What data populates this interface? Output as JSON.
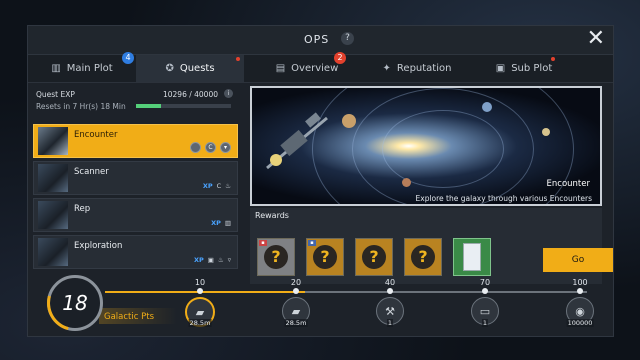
{
  "window": {
    "title": "OPS",
    "help_glyph": "?",
    "close_glyph": "✕"
  },
  "tabs": [
    {
      "label": "Main Plot",
      "icon": "book-icon",
      "badge": "4"
    },
    {
      "label": "Quests",
      "icon": "target-icon",
      "active": true
    },
    {
      "label": "Overview",
      "icon": "list-icon",
      "badge": "2"
    },
    {
      "label": "Reputation",
      "icon": "medal-icon"
    },
    {
      "label": "Sub Plot",
      "icon": "document-icon"
    }
  ],
  "quest_exp": {
    "label": "Quest EXP",
    "value": "10296 / 40000",
    "reset": "Resets in 7 Hr(s) 18 Min",
    "progress": 0.26
  },
  "quests": [
    {
      "name": "Encounter",
      "selected": true,
      "tags": [
        "C"
      ]
    },
    {
      "name": "Scanner",
      "tags": [
        "XP",
        "C"
      ]
    },
    {
      "name": "Rep",
      "tags": [
        "XP"
      ]
    },
    {
      "name": "Exploration",
      "tags": [
        "XP"
      ]
    }
  ],
  "hero": {
    "title": "Encounter",
    "description": "Explore the galaxy through various Encounters"
  },
  "rewards": {
    "label": "Rewards",
    "go_label": "Go"
  },
  "galactic": {
    "value": "18",
    "label": "Galactic Pts",
    "progress": 0.18,
    "milestones": [
      {
        "points": "10",
        "count": "28.5m",
        "reached": true
      },
      {
        "points": "20",
        "count": "28.5m"
      },
      {
        "points": "40",
        "count": "1"
      },
      {
        "points": "70",
        "count": "1"
      },
      {
        "points": "100",
        "count": "100000"
      }
    ]
  },
  "colors": {
    "accent": "#f1ad17",
    "badge_blue": "#2f7de1",
    "badge_red": "#e2412d",
    "progress_green": "#55d07a"
  }
}
